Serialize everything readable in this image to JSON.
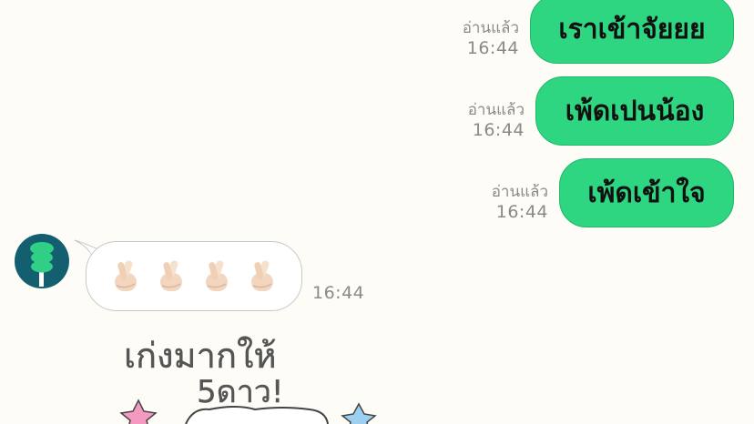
{
  "chat": {
    "sent_messages": [
      {
        "read_label": "อ่านแล้ว",
        "time": "16:44",
        "text": "เราเข้าจัยยย"
      },
      {
        "read_label": "อ่านแล้ว",
        "time": "16:44",
        "text": "เพ้ดเปนน้อง"
      },
      {
        "read_label": "อ่านแล้ว",
        "time": "16:44",
        "text": "เพ้ดเข้าใจ"
      }
    ],
    "received": {
      "avatar_icon": "green-character-avatar-icon",
      "emoji_icons": [
        "hand-with-index-finger-and-thumb-crossed",
        "hand-with-index-finger-and-thumb-crossed",
        "hand-with-index-finger-and-thumb-crossed",
        "hand-with-index-finger-and-thumb-crossed"
      ],
      "time": "16:44"
    },
    "sticker": {
      "line1": "เก่งมากให้",
      "line2": "5ดาว!"
    }
  },
  "colors": {
    "background": "#fdfcf6",
    "sent_bubble": "#2ed681",
    "meta_text": "#8a8a8a",
    "avatar": "#145f6f"
  }
}
